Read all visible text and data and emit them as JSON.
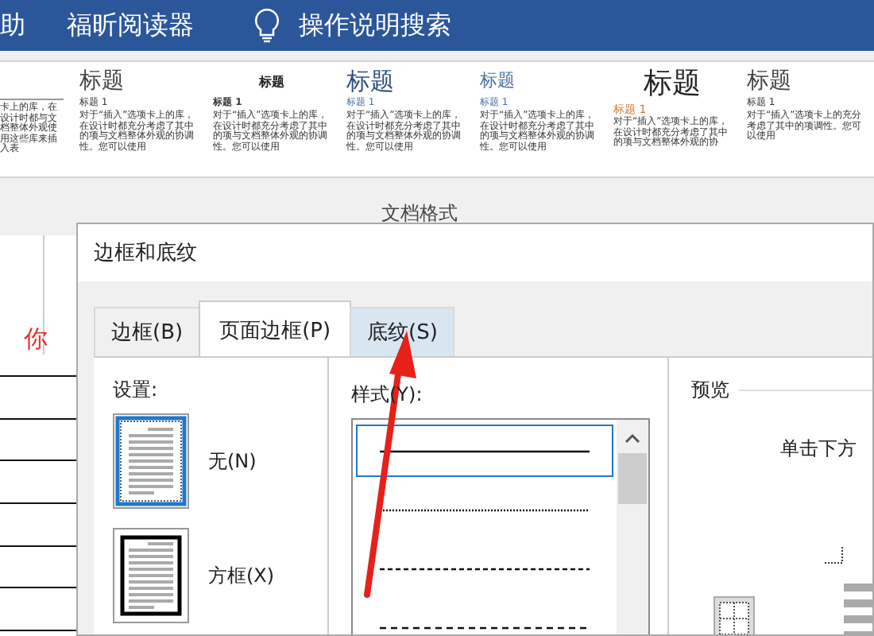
{
  "ribbon": {
    "tabs": [
      {
        "label": "助"
      },
      {
        "label": "福昕阅读器"
      }
    ],
    "search": {
      "label": "操作说明搜索"
    }
  },
  "style_gallery": [
    {
      "kind": "partial",
      "body": "卡上的库，在设计时都与文档整体外观使用这些库来插入表"
    },
    {
      "kind": "basic",
      "title": "标题",
      "heading": "标题 1",
      "body": "对于“插入”选项卡上的库，在设计时都充分考虑了其中的项与文档整体外观的协调性。您可以使用"
    },
    {
      "kind": "bold",
      "title": "标题",
      "heading": "标题 1",
      "body": "对于“插入”选项卡上的库，在设计时都充分考虑了其中的项与文档整体外观的协调性。您可以使用"
    },
    {
      "kind": "blue",
      "title": "标题",
      "heading": "标题 1",
      "body": "对于“插入”选项卡上的库，在设计时都充分考虑了其中的项与文档整体外观的协调性。您可以使用"
    },
    {
      "kind": "blue-small",
      "title": "标题",
      "heading": "标题 1",
      "body": "对于“插入”选项卡上的库，在设计时都充分考虑了其中的项与文档整体外观的协调性。您可以使用"
    },
    {
      "kind": "large",
      "title": "标题",
      "heading": "标题 1",
      "body": "对于“插入”选项卡上的库，在设计时都充分考虑了其中的项与文档整体外观的协"
    },
    {
      "kind": "basic",
      "title": "标题",
      "heading": "标题 1",
      "body": "对于“插入”选项卡上的充分考虑了其中的项调性。您可以使用"
    }
  ],
  "group_label": "文档格式",
  "document": {
    "text": "你"
  },
  "dialog": {
    "title": "边框和底纹",
    "tabs": [
      {
        "label": "边框(B)",
        "selected": false,
        "hovered": false
      },
      {
        "label": "页面边框(P)",
        "selected": true,
        "hovered": false
      },
      {
        "label": "底纹(S)",
        "selected": false,
        "hovered": true
      }
    ],
    "settings": {
      "label": "设置:",
      "options": [
        {
          "label": "无(N)",
          "kind": "none",
          "selected": true
        },
        {
          "label": "方框(X)",
          "kind": "box",
          "selected": false
        }
      ]
    },
    "style_list": {
      "label": "样式(Y):",
      "items": [
        {
          "kind": "solid",
          "selected": true
        },
        {
          "kind": "dotted",
          "selected": false
        },
        {
          "kind": "dashed",
          "selected": false
        },
        {
          "kind": "dashed-wide",
          "selected": false
        }
      ]
    },
    "preview": {
      "label": "预览",
      "hint": "单击下方"
    }
  }
}
